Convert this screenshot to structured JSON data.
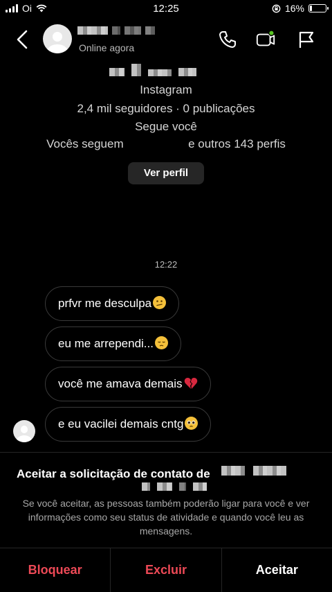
{
  "status_bar": {
    "carrier": "Oi",
    "time": "12:25",
    "battery": "16%",
    "battery_level": 0.16
  },
  "header": {
    "status": "Online agora",
    "icons": [
      "back-arrow-icon",
      "phone-icon",
      "video-call-icon",
      "flag-icon"
    ],
    "video_active_color": "#58c322"
  },
  "profile": {
    "platform": "Instagram",
    "stats": "2,4 mil seguidores · 0 publicações",
    "follows_you": "Segue você",
    "mutual_prefix": "Vocês seguem",
    "mutual_suffix": "e outros 143 perfis",
    "view_profile": "Ver perfil"
  },
  "conversation": {
    "timestamp": "12:22",
    "messages": [
      {
        "text": "prfvr me desculpa",
        "emoji": "confused-face-icon"
      },
      {
        "text": "eu me arrependi...",
        "emoji": "pensive-face-icon"
      },
      {
        "text": "você me amava demais",
        "emoji": "broken-heart-icon"
      },
      {
        "text": "e eu vacilei demais cntg",
        "emoji": "pleading-face-icon"
      }
    ]
  },
  "request": {
    "title": "Aceitar a solicitação de contato de",
    "description": "Se você aceitar, as pessoas também poderão ligar para você e ver informações como seu status de atividade e quando você leu as mensagens.",
    "block_label": "Bloquear",
    "delete_label": "Excluir",
    "accept_label": "Aceitar",
    "danger_color": "#ed4956"
  }
}
